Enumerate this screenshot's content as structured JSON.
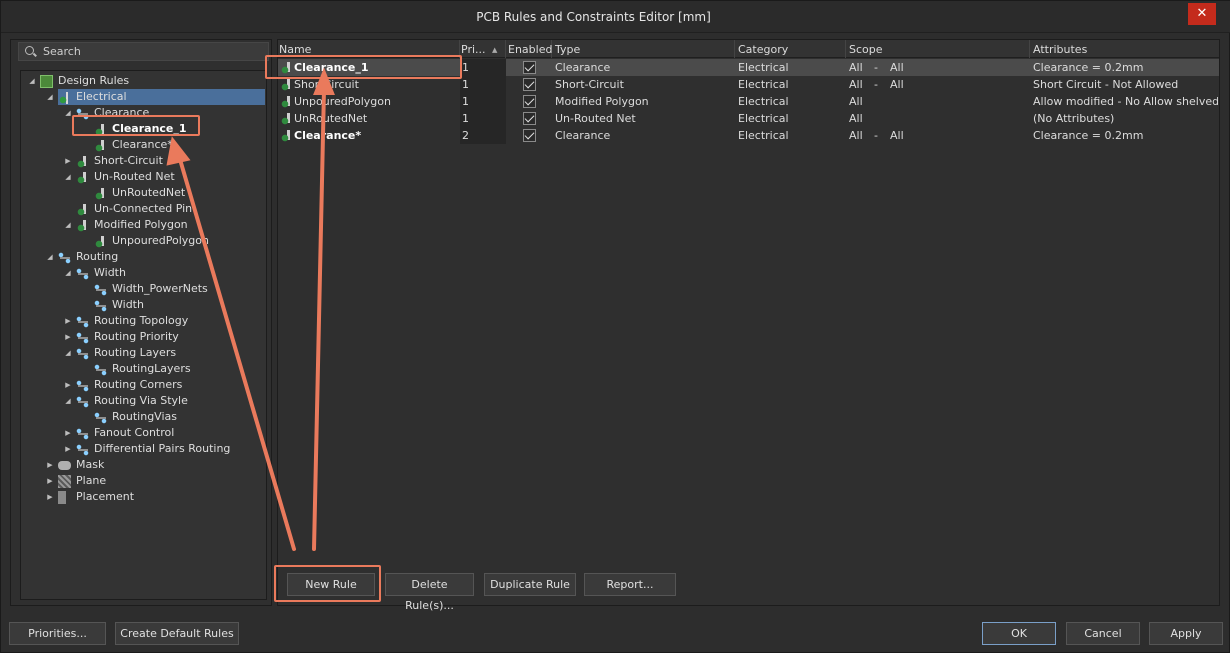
{
  "window": {
    "title": "PCB Rules and Constraints Editor [mm]",
    "close_glyph": "✕"
  },
  "search": {
    "label": "Search"
  },
  "tree": [
    {
      "label": "Design Rules",
      "arrow": "◢",
      "icon": "root"
    },
    {
      "label": "Electrical",
      "arrow": "◢",
      "icon": "elec"
    },
    {
      "label": "Clearance",
      "arrow": "◢",
      "icon": "cat"
    },
    {
      "label": "Clearance_1",
      "arrow": "",
      "icon": "rule"
    },
    {
      "label": "Clearance*",
      "arrow": "",
      "icon": "rule"
    },
    {
      "label": "Short-Circuit",
      "arrow": "▶",
      "icon": "rule"
    },
    {
      "label": "Un-Routed Net",
      "arrow": "◢",
      "icon": "rule"
    },
    {
      "label": "UnRoutedNet",
      "arrow": "",
      "icon": "rule"
    },
    {
      "label": "Un-Connected Pin",
      "arrow": "",
      "icon": "rule"
    },
    {
      "label": "Modified Polygon",
      "arrow": "◢",
      "icon": "rule"
    },
    {
      "label": "UnpouredPolygon",
      "arrow": "",
      "icon": "rule"
    },
    {
      "label": "Routing",
      "arrow": "◢",
      "icon": "cat"
    },
    {
      "label": "Width",
      "arrow": "◢",
      "icon": "cat"
    },
    {
      "label": "Width_PowerNets",
      "arrow": "",
      "icon": "cat"
    },
    {
      "label": "Width",
      "arrow": "",
      "icon": "cat"
    },
    {
      "label": "Routing Topology",
      "arrow": "▶",
      "icon": "cat"
    },
    {
      "label": "Routing Priority",
      "arrow": "▶",
      "icon": "cat"
    },
    {
      "label": "Routing Layers",
      "arrow": "◢",
      "icon": "cat"
    },
    {
      "label": "RoutingLayers",
      "arrow": "",
      "icon": "cat"
    },
    {
      "label": "Routing Corners",
      "arrow": "▶",
      "icon": "cat"
    },
    {
      "label": "Routing Via Style",
      "arrow": "◢",
      "icon": "cat"
    },
    {
      "label": "RoutingVias",
      "arrow": "",
      "icon": "cat"
    },
    {
      "label": "Fanout Control",
      "arrow": "▶",
      "icon": "cat"
    },
    {
      "label": "Differential Pairs Routing",
      "arrow": "▶",
      "icon": "cat"
    },
    {
      "label": "Mask",
      "arrow": "▶",
      "icon": "mask"
    },
    {
      "label": "Plane",
      "arrow": "▶",
      "icon": "plane"
    },
    {
      "label": "Placement",
      "arrow": "▶",
      "icon": "place"
    }
  ],
  "grid": {
    "columns": [
      "Name",
      "Pri...",
      "Enabled",
      "Type",
      "Category",
      "Scope",
      "Attributes"
    ],
    "sort_glyph": "▲",
    "rows": [
      {
        "name": "Clearance_1",
        "priority": "1",
        "type": "Clearance",
        "category": "Electrical",
        "scope1": "All",
        "scope_sep": "-",
        "scope2": "All",
        "attributes": "Clearance = 0.2mm"
      },
      {
        "name": "ShortCircuit",
        "priority": "1",
        "type": "Short-Circuit",
        "category": "Electrical",
        "scope1": "All",
        "scope_sep": "-",
        "scope2": "All",
        "attributes": "Short Circuit - Not Allowed"
      },
      {
        "name": "UnpouredPolygon",
        "priority": "1",
        "type": "Modified Polygon",
        "category": "Electrical",
        "scope1": "All",
        "scope_sep": "",
        "scope2": "",
        "attributes": "Allow modified - No  Allow shelved"
      },
      {
        "name": "UnRoutedNet",
        "priority": "1",
        "type": "Un-Routed Net",
        "category": "Electrical",
        "scope1": "All",
        "scope_sep": "",
        "scope2": "",
        "attributes": "(No Attributes)"
      },
      {
        "name": "Clearance*",
        "priority": "2",
        "type": "Clearance",
        "category": "Electrical",
        "scope1": "All",
        "scope_sep": "-",
        "scope2": "All",
        "attributes": "Clearance = 0.2mm"
      }
    ]
  },
  "buttons": {
    "new_rule": "New Rule",
    "delete_rules": "Delete Rule(s)...",
    "duplicate_rule": "Duplicate Rule",
    "report": "Report...",
    "priorities": "Priorities...",
    "create_default_rules": "Create Default Rules",
    "ok": "OK",
    "cancel": "Cancel",
    "apply": "Apply"
  },
  "colors": {
    "highlight": "#ea7a5c",
    "selection": "#4a6f9b",
    "close": "#c42b1c"
  }
}
